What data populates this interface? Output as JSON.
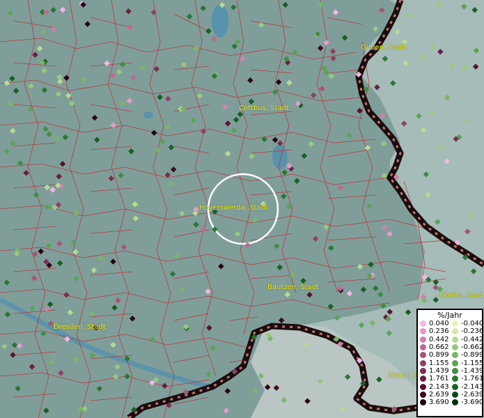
{
  "map": {
    "cities": [
      {
        "id": "guben",
        "name": "Guben, Stadt"
      },
      {
        "id": "cottbus",
        "name": "Cottbus, Stadt"
      },
      {
        "id": "hoyerswerda",
        "name": "Hoyerswerda, Stadt"
      },
      {
        "id": "bautzen",
        "name": "Bautzen, Stadt"
      },
      {
        "id": "dresden",
        "name": "Dresden, Stadt"
      },
      {
        "id": "goerlitz",
        "name": "Görlitz, Stadt"
      },
      {
        "id": "zittau",
        "name": "Zittau, St"
      }
    ]
  },
  "legend": {
    "title": "%/Jahr",
    "positive": [
      {
        "label": "0.040",
        "color": "#f5b5e6"
      },
      {
        "label": "0.236",
        "color": "#e49ccb"
      },
      {
        "label": "0.442",
        "color": "#cf82ac"
      },
      {
        "label": "0.662",
        "color": "#bd6a92"
      },
      {
        "label": "0.899",
        "color": "#a8537a"
      },
      {
        "label": "1.155",
        "color": "#933f64"
      },
      {
        "label": "1.439",
        "color": "#7e2d50"
      },
      {
        "label": "1.761",
        "color": "#6a1f3f"
      },
      {
        "label": "2.143",
        "color": "#55132f"
      },
      {
        "label": "2.639",
        "color": "#3f0a20"
      },
      {
        "label": "3.690",
        "color": "#270313"
      }
    ],
    "negative": [
      {
        "label": "-0.040",
        "color": "#ebf5b2"
      },
      {
        "label": "-0.236",
        "color": "#d3e9a5"
      },
      {
        "label": "-0.442",
        "color": "#b7da93"
      },
      {
        "label": "-0.662",
        "color": "#98c97f"
      },
      {
        "label": "-0.899",
        "color": "#79b66a"
      },
      {
        "label": "-1.155",
        "color": "#5ba356"
      },
      {
        "label": "-1.439",
        "color": "#408e43"
      },
      {
        "label": "-1.761",
        "color": "#297733"
      },
      {
        "label": "-2.143",
        "color": "#176024"
      },
      {
        "label": "-2.639",
        "color": "#0b4818"
      },
      {
        "label": "-3.690",
        "color": "#04300e"
      }
    ]
  }
}
